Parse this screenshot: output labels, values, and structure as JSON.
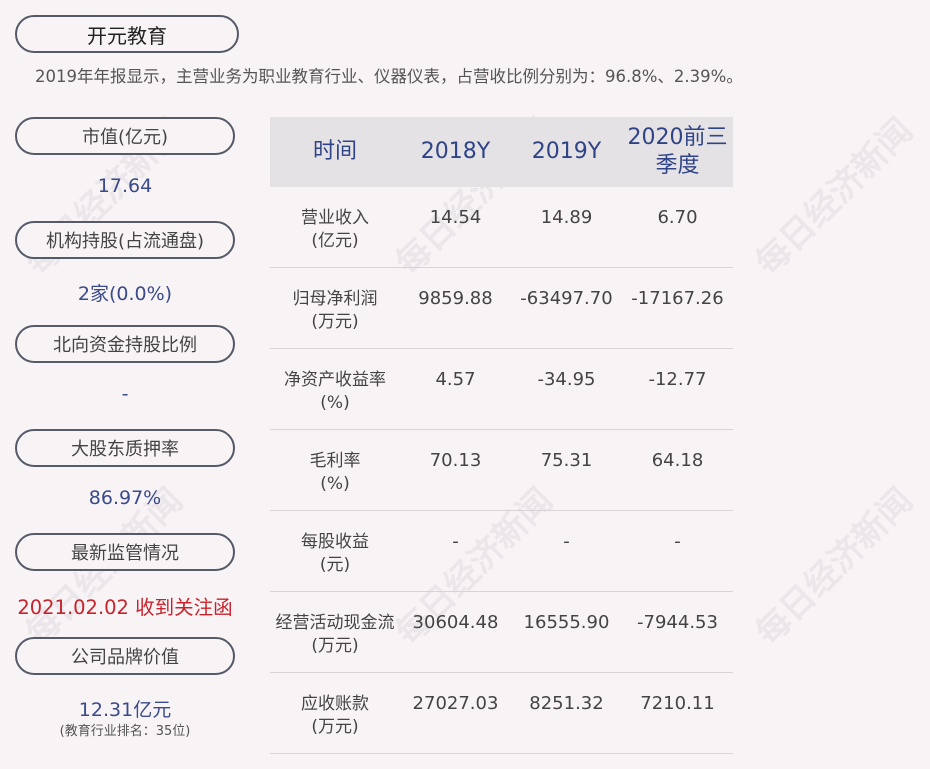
{
  "company": "开元教育",
  "summary": "2019年年报显示，主营业务为职业教育行业、仪器仪表，占营收比例分别为：96.8%、2.39%。",
  "metrics": [
    {
      "label": "市值(亿元)",
      "value": "17.64"
    },
    {
      "label": "机构持股(占流通盘)",
      "value": "2家(0.0%)"
    },
    {
      "label": "北向资金持股比例",
      "value": "-"
    },
    {
      "label": "大股东质押率",
      "value": "86.97%"
    },
    {
      "label": "最新监管情况",
      "value": "2021.02.02 收到关注函"
    },
    {
      "label": "公司品牌价值",
      "value": "12.31亿元",
      "note": "(教育行业排名：35位)"
    }
  ],
  "table": {
    "headers": [
      "时间",
      "2018Y",
      "2019Y",
      "2020前三季度"
    ],
    "rows": [
      {
        "name": "营业收入",
        "unit": "(亿元)",
        "values": [
          "14.54",
          "14.89",
          "6.70"
        ]
      },
      {
        "name": "归母净利润",
        "unit": "(万元)",
        "values": [
          "9859.88",
          "-63497.70",
          "-17167.26"
        ]
      },
      {
        "name": "净资产收益率",
        "unit": "(%)",
        "values": [
          "4.57",
          "-34.95",
          "-12.77"
        ]
      },
      {
        "name": "毛利率",
        "unit": "(%)",
        "values": [
          "70.13",
          "75.31",
          "64.18"
        ]
      },
      {
        "name": "每股收益",
        "unit": "(元)",
        "values": [
          "-",
          "-",
          "-"
        ]
      },
      {
        "name": "经营活动现金流",
        "unit": "(万元)",
        "values": [
          "30604.48",
          "16555.90",
          "-7944.53"
        ]
      },
      {
        "name": "应收账款",
        "unit": "(万元)",
        "values": [
          "27027.03",
          "8251.32",
          "7210.11"
        ]
      }
    ]
  },
  "watermark": "每日经济新闻",
  "colors": {
    "accent_blue": "#2f4487",
    "alert_red": "#c8232c",
    "header_bg": "#e5e2e6",
    "page_bg": "#f8f4f6"
  }
}
